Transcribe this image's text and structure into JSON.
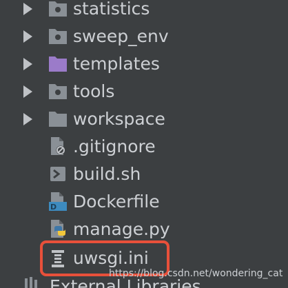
{
  "tree": {
    "items": [
      {
        "label": "statistics",
        "type": "package-folder",
        "expandable": true
      },
      {
        "label": "sweep_env",
        "type": "package-folder",
        "expandable": true
      },
      {
        "label": "templates",
        "type": "templates-folder",
        "expandable": true
      },
      {
        "label": "tools",
        "type": "package-folder",
        "expandable": true
      },
      {
        "label": "workspace",
        "type": "folder",
        "expandable": true
      },
      {
        "label": ".gitignore",
        "type": "gitignore-file",
        "expandable": false
      },
      {
        "label": "build.sh",
        "type": "shell-file",
        "expandable": false
      },
      {
        "label": "Dockerfile",
        "type": "docker-file",
        "expandable": false
      },
      {
        "label": "manage.py",
        "type": "python-file",
        "expandable": false
      },
      {
        "label": "uwsgi.ini",
        "type": "ini-file",
        "expandable": false,
        "highlighted": true
      }
    ],
    "partial_item": {
      "label": "External Libraries",
      "type": "libraries"
    }
  },
  "watermark": "https://blog.csdn.net/wondering_cat",
  "colors": {
    "background": "#3c3f41",
    "text": "#cdd0d4",
    "folder": "#8a9096",
    "templates_folder": "#9b7bc9",
    "highlight_border": "#e8503a",
    "docker_badge": "#3d8bbf",
    "python_blue": "#3e77a8",
    "python_yellow": "#f2c73b"
  }
}
